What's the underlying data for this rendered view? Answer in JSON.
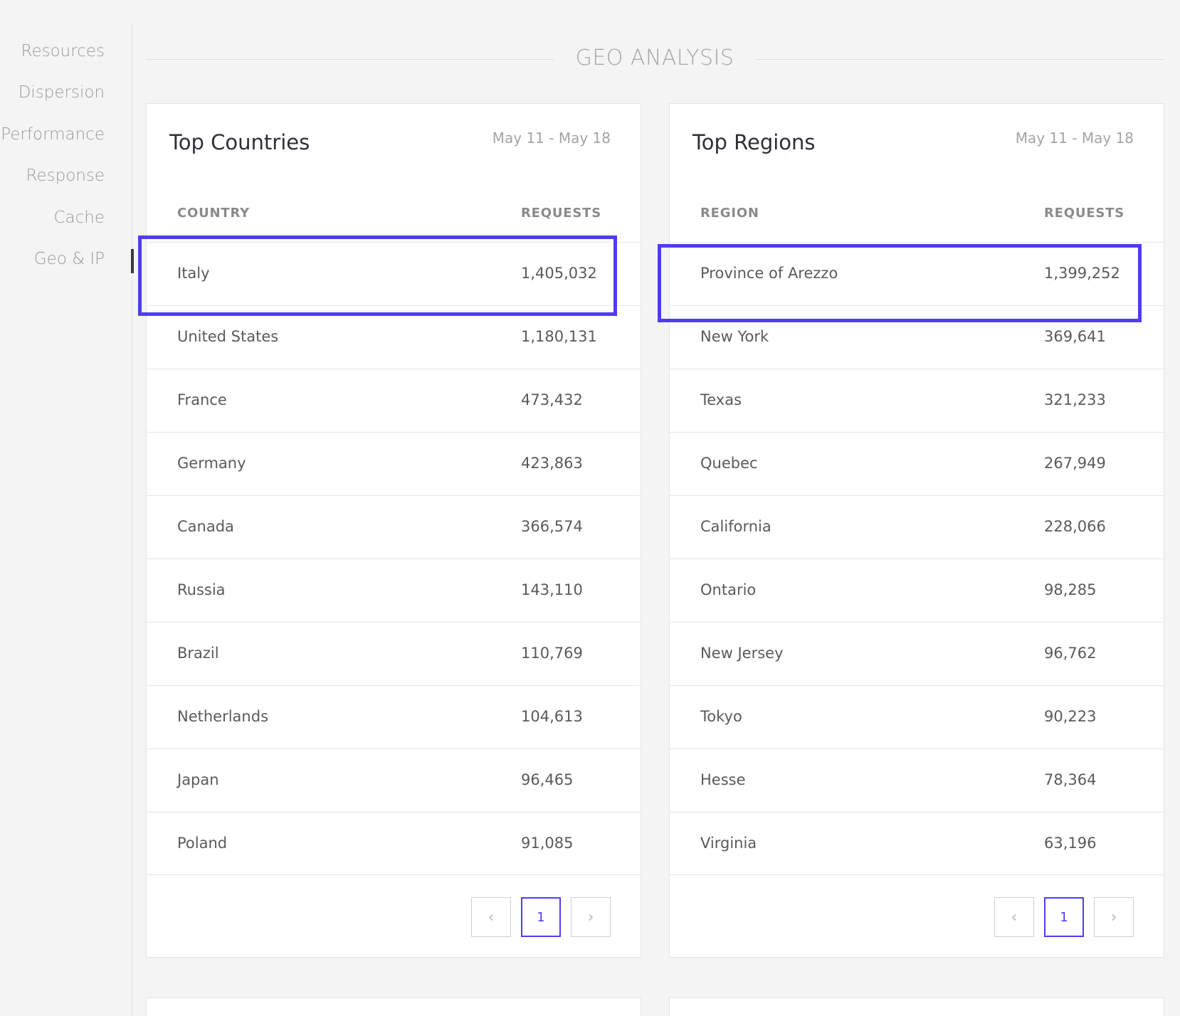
{
  "sidebar": {
    "items": [
      {
        "label": "Resources"
      },
      {
        "label": "Dispersion"
      },
      {
        "label": "Performance"
      },
      {
        "label": "Response"
      },
      {
        "label": "Cache"
      },
      {
        "label": "Geo & IP"
      }
    ],
    "active_index": 5
  },
  "section": {
    "title": "GEO ANALYSIS"
  },
  "countries": {
    "title": "Top Countries",
    "date_range": "May 11 - May 18",
    "col_name": "COUNTRY",
    "col_requests": "REQUESTS",
    "rows": [
      {
        "name": "Italy",
        "requests": "1,405,032"
      },
      {
        "name": "United States",
        "requests": "1,180,131"
      },
      {
        "name": "France",
        "requests": "473,432"
      },
      {
        "name": "Germany",
        "requests": "423,863"
      },
      {
        "name": "Canada",
        "requests": "366,574"
      },
      {
        "name": "Russia",
        "requests": "143,110"
      },
      {
        "name": "Brazil",
        "requests": "110,769"
      },
      {
        "name": "Netherlands",
        "requests": "104,613"
      },
      {
        "name": "Japan",
        "requests": "96,465"
      },
      {
        "name": "Poland",
        "requests": "91,085"
      }
    ],
    "pager": {
      "prev": "‹",
      "current": "1",
      "next": "›"
    }
  },
  "regions": {
    "title": "Top Regions",
    "date_range": "May 11 - May 18",
    "col_name": "REGION",
    "col_requests": "REQUESTS",
    "rows": [
      {
        "name": "Province of Arezzo",
        "requests": "1,399,252"
      },
      {
        "name": "New York",
        "requests": "369,641"
      },
      {
        "name": "Texas",
        "requests": "321,233"
      },
      {
        "name": "Quebec",
        "requests": "267,949"
      },
      {
        "name": "California",
        "requests": "228,066"
      },
      {
        "name": "Ontario",
        "requests": "98,285"
      },
      {
        "name": "New Jersey",
        "requests": "96,762"
      },
      {
        "name": "Tokyo",
        "requests": "90,223"
      },
      {
        "name": "Hesse",
        "requests": "78,364"
      },
      {
        "name": "Virginia",
        "requests": "63,196"
      }
    ],
    "pager": {
      "prev": "‹",
      "current": "1",
      "next": "›"
    }
  },
  "colors": {
    "accent": "#4f3cf0",
    "background": "#f4f4f4",
    "card": "#ffffff"
  }
}
